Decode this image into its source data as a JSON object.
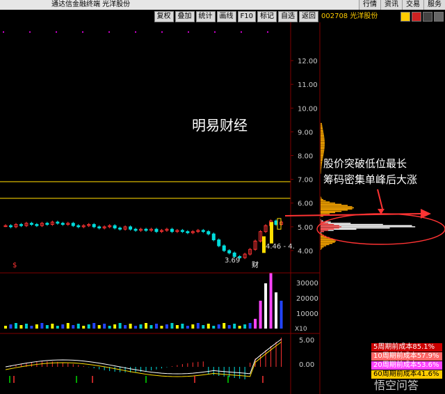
{
  "titlebar": {
    "app_title": "通达信金融终端  光洋股份",
    "menus": [
      "行情",
      "资讯",
      "交易",
      "服务"
    ]
  },
  "toolbar": {
    "buttons": [
      "复权",
      "叠加",
      "统计",
      "画线",
      "F10",
      "标记",
      "自选",
      "返回"
    ]
  },
  "stock": {
    "code_name": "002708 光洋股份"
  },
  "price_axis": {
    "ticks": [
      "12.00",
      "11.00",
      "10.00",
      "9.00",
      "8.00",
      "7.00",
      "6.00",
      "5.00",
      "4.00"
    ]
  },
  "volume_axis": {
    "ticks": [
      "30000",
      "20000",
      "10000"
    ],
    "unit": "X10"
  },
  "indicator_axis": {
    "ticks": [
      "5.00",
      "0.00"
    ]
  },
  "annotations": {
    "watermark": "明易财经",
    "caption_line1": "股价突破低位最长",
    "caption_line2": "筹码密集单峰后大涨",
    "low_price": "3.69",
    "range_label": "4.46 - 4.",
    "cai_mark": "财",
    "s_mark": "$"
  },
  "cost_list": [
    {
      "label": "5周期前成本85.1%",
      "bg": "#cc0000",
      "fg": "#ffffff"
    },
    {
      "label": "10周期前成本57.9%",
      "bg": "#ff6666",
      "fg": "#ffffff"
    },
    {
      "label": "20周期前成本53.6%",
      "bg": "#ff44ff",
      "fg": "#ffffff"
    },
    {
      "label": "60周期前成本41.6%",
      "bg": "#ffcc00",
      "fg": "#000000"
    }
  ],
  "watermark_logo": "悟空问答",
  "colors": {
    "up": "#ff3333",
    "down": "#00dddd",
    "accent_line": "#d9b800",
    "chip_yellow": "#ffaa00",
    "chip_white": "#ffffff",
    "chip_red": "#ff3333",
    "axis": "#800000"
  },
  "chart_data": {
    "type": "candlestick",
    "ylim": [
      3.5,
      12.5
    ],
    "horizontal_levels": [
      6.9,
      6.2
    ],
    "closes": [
      5.05,
      5.0,
      5.1,
      5.05,
      5.15,
      5.1,
      5.05,
      5.15,
      5.1,
      5.2,
      5.15,
      5.1,
      5.15,
      5.05,
      5.0,
      5.05,
      5.1,
      5.0,
      4.95,
      5.0,
      5.05,
      4.95,
      4.9,
      5.0,
      4.9,
      4.85,
      4.9,
      4.85,
      4.9,
      4.8,
      4.85,
      4.9,
      4.8,
      4.85,
      4.8,
      4.75,
      4.8,
      4.85,
      4.8,
      4.7,
      4.45,
      4.2,
      4.0,
      3.9,
      3.75,
      3.7,
      3.85,
      4.05,
      4.4,
      4.8,
      5.05,
      5.25,
      5.1,
      5.2
    ]
  }
}
